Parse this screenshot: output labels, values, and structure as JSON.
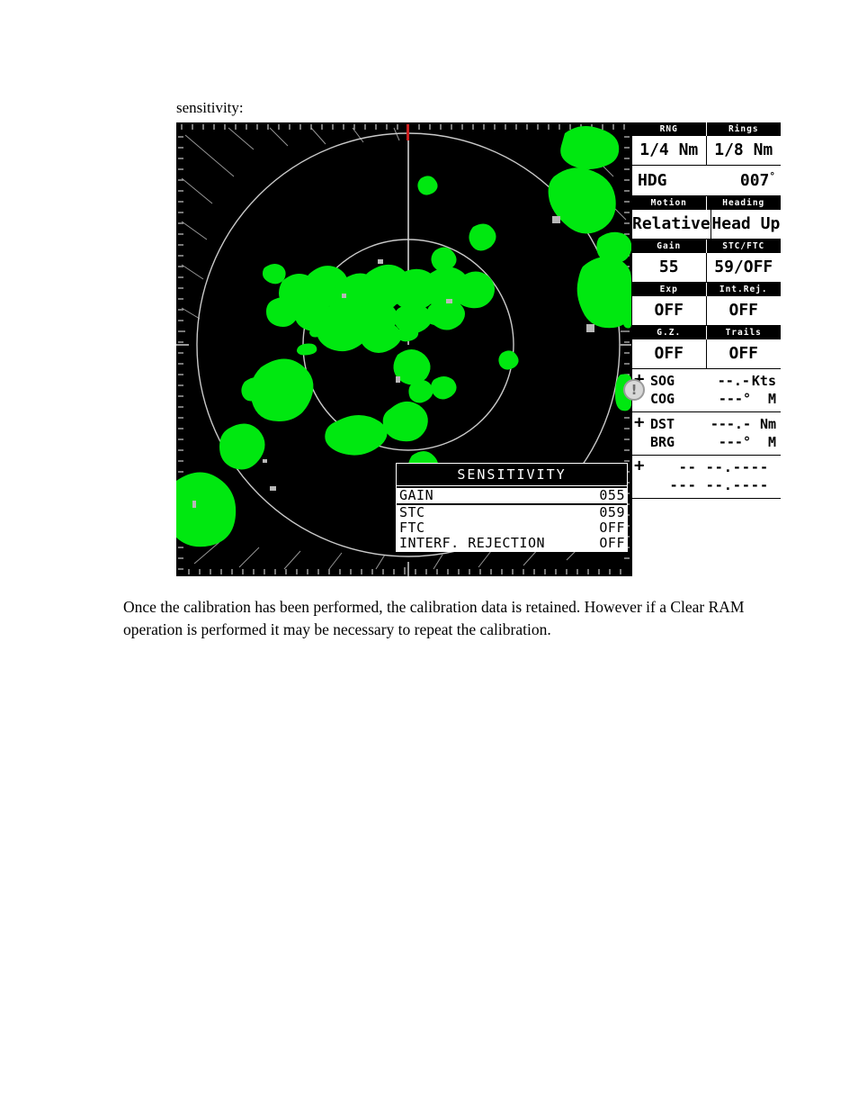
{
  "document": {
    "intro_line": "sensitivity:",
    "closing_paragraph": "Once the calibration has been performed, the calibration data is retained. However if a Clear RAM operation is performed it may be necessary to repeat the calibration."
  },
  "radar": {
    "background_color": "#000000",
    "echo_color": "#00e810",
    "ring_color": "#c8c8c8",
    "heading_marker_color": "#cc1f1f",
    "warning_badge": "!",
    "panel": {
      "rng": {
        "header": "RNG",
        "value": "1/4 Nm"
      },
      "rings": {
        "header": "Rings",
        "value": "1/8 Nm"
      },
      "hdg": {
        "label": "HDG",
        "value": "007",
        "unit": "°"
      },
      "motion": {
        "header": "Motion",
        "value": "Relative"
      },
      "heading_mode": {
        "header": "Heading",
        "value": "Head Up"
      },
      "gain": {
        "header": "Gain",
        "value": "55"
      },
      "stc_ftc": {
        "header": "STC/FTC",
        "value": "59/OFF"
      },
      "exp": {
        "header": "Exp",
        "value": "OFF"
      },
      "int_rej": {
        "header": "Int.Rej.",
        "value": "OFF"
      },
      "gz": {
        "header": "G.Z.",
        "value": "OFF"
      },
      "trails": {
        "header": "Trails",
        "value": "OFF"
      },
      "nav": [
        {
          "key": "SOG",
          "value": "--.-",
          "unit": "Kts"
        },
        {
          "key": "COG",
          "value": "---°",
          "unit": "M"
        },
        {
          "key": "DST",
          "value": "---.-",
          "unit": "Nm"
        },
        {
          "key": "BRG",
          "value": "---°",
          "unit": "M"
        }
      ],
      "position": {
        "latitude": "-- --.----",
        "longitude": "--- --.----"
      }
    },
    "sensitivity_dialog": {
      "title": "SENSITIVITY",
      "rows": [
        {
          "label": "GAIN",
          "value": "055",
          "selected": true
        },
        {
          "label": "STC",
          "value": "059",
          "selected": false
        },
        {
          "label": "FTC",
          "value": "OFF",
          "selected": false
        },
        {
          "label": "INTERF. REJECTION",
          "value": "OFF",
          "selected": false
        }
      ]
    }
  }
}
